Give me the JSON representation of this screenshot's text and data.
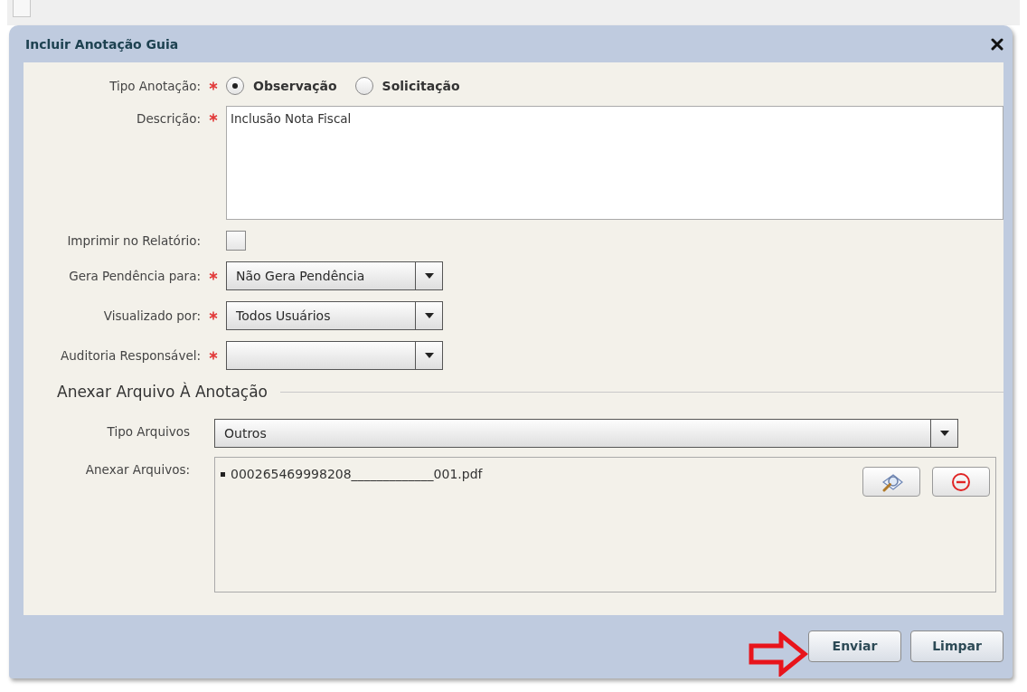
{
  "background_checkbox": {
    "checked": false
  },
  "dialog": {
    "title": "Incluir Anotação Guia"
  },
  "fields": [
    {
      "kind": "radio",
      "label": "Tipo Anotação:",
      "required": true,
      "options": [
        {
          "label": "Observação",
          "selected": true
        },
        {
          "label": "Solicitação",
          "selected": false
        }
      ]
    },
    {
      "kind": "textarea",
      "label": "Descrição:",
      "required": true,
      "value": "Inclusão Nota Fiscal"
    },
    {
      "kind": "checkbox",
      "label": "Imprimir no Relatório:",
      "required": false,
      "checked": false
    },
    {
      "kind": "select",
      "label": "Gera Pendência para:",
      "required": true,
      "value": "Não Gera Pendência"
    },
    {
      "kind": "select",
      "label": "Visualizado por:",
      "required": true,
      "value": "Todos Usuários"
    },
    {
      "kind": "select",
      "label": "Auditoria Responsável:",
      "required": true
    }
  ],
  "attachment_section": {
    "title": "Anexar Arquivo À Anotação",
    "file_type": {
      "label": "Tipo Arquivos",
      "value": "Outros"
    },
    "files": {
      "label": "Anexar Arquivos:",
      "items": [
        {
          "name": "000265469998208_____________001.pdf"
        }
      ]
    }
  },
  "buttons": [
    {
      "label": "Enviar",
      "highlighted": true
    },
    {
      "label": "Limpar",
      "highlighted": false
    }
  ]
}
